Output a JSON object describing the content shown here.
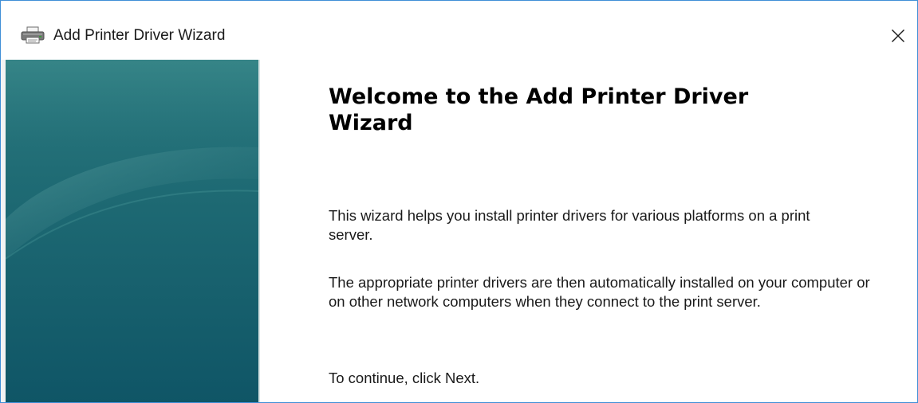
{
  "window": {
    "title": "Add Printer Driver Wizard",
    "icon": "printer-icon",
    "close_icon": "close-icon",
    "border_color": "#3f8fd7"
  },
  "banner": {
    "colors": {
      "top": "#2c7a80",
      "bottom": "#0f5566"
    }
  },
  "content": {
    "heading": "Welcome to the Add Printer Driver Wizard",
    "paragraph_1": "This wizard helps you install printer drivers for various platforms on a print server.",
    "paragraph_2": "The appropriate printer drivers are then automatically installed on your computer or on other network computers when they connect to the print server.",
    "paragraph_3": "To continue, click Next."
  }
}
